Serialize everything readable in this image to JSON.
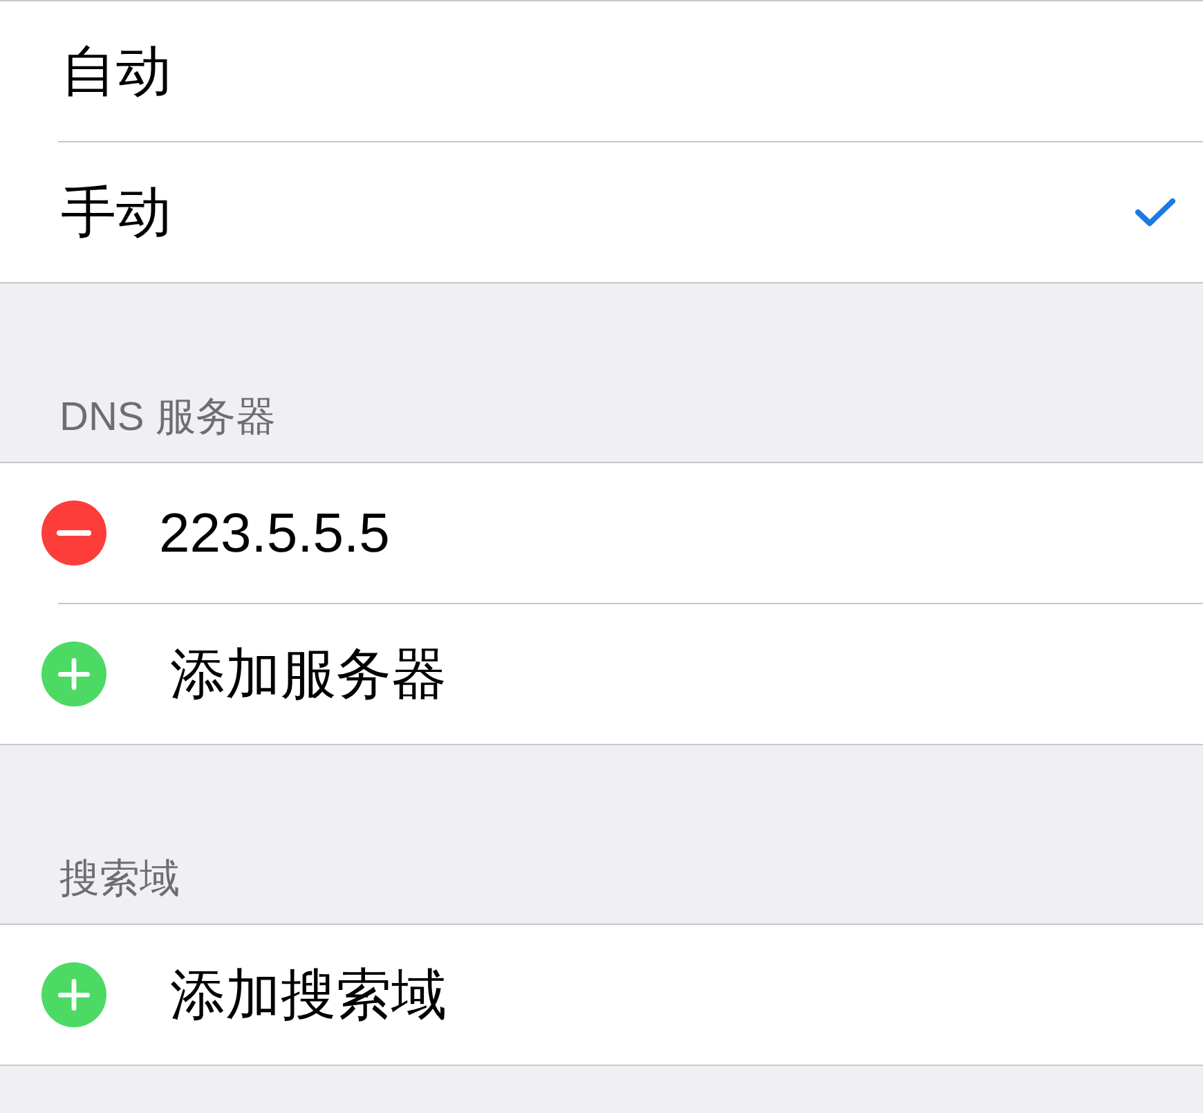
{
  "mode_options": [
    {
      "label": "自动",
      "selected": false
    },
    {
      "label": "手动",
      "selected": true
    }
  ],
  "sections": [
    {
      "header": "DNS 服务器",
      "rows": [
        {
          "kind": "remove",
          "label": "223.5.5.5"
        },
        {
          "kind": "add",
          "label": "添加服务器"
        }
      ]
    },
    {
      "header": "搜索域",
      "rows": [
        {
          "kind": "add",
          "label": "添加搜索域"
        }
      ]
    }
  ]
}
